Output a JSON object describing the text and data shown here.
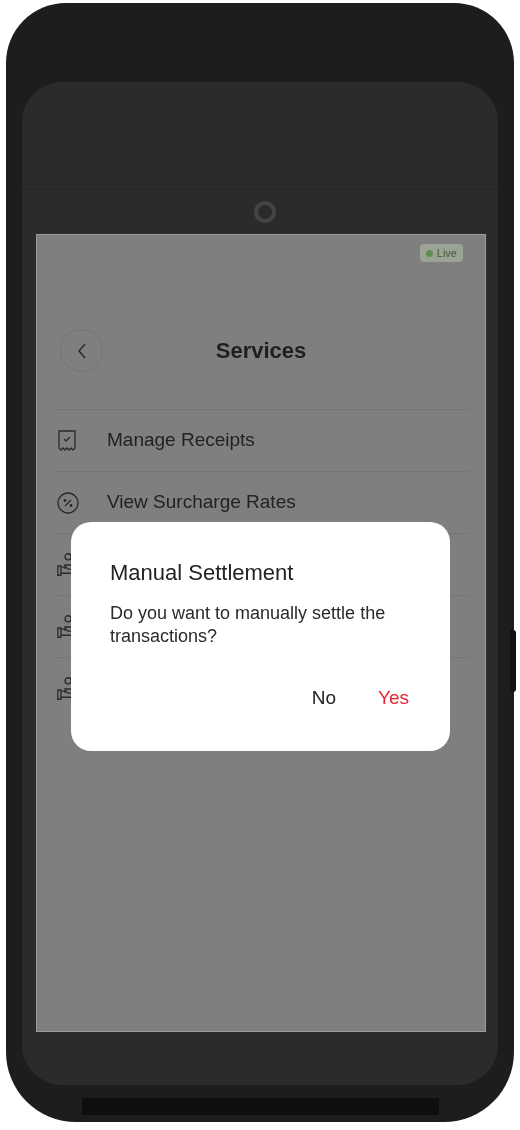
{
  "status_bar": {
    "badge": {
      "label": "Live",
      "live": true
    }
  },
  "header": {
    "title": "Services"
  },
  "items": [
    {
      "kind": "receipt",
      "label": "Manage Receipts"
    },
    {
      "kind": "percent",
      "label": "View Surcharge Rates"
    },
    {
      "kind": "payment"
    },
    {
      "kind": "payment"
    },
    {
      "kind": "payment"
    }
  ],
  "dialog": {
    "title": "Manual Settlement",
    "message": "Do you want to manually settle the transactions?",
    "buttons": [
      {
        "label": "No",
        "kind": "cancel"
      },
      {
        "label": "Yes",
        "kind": "confirm"
      }
    ]
  }
}
